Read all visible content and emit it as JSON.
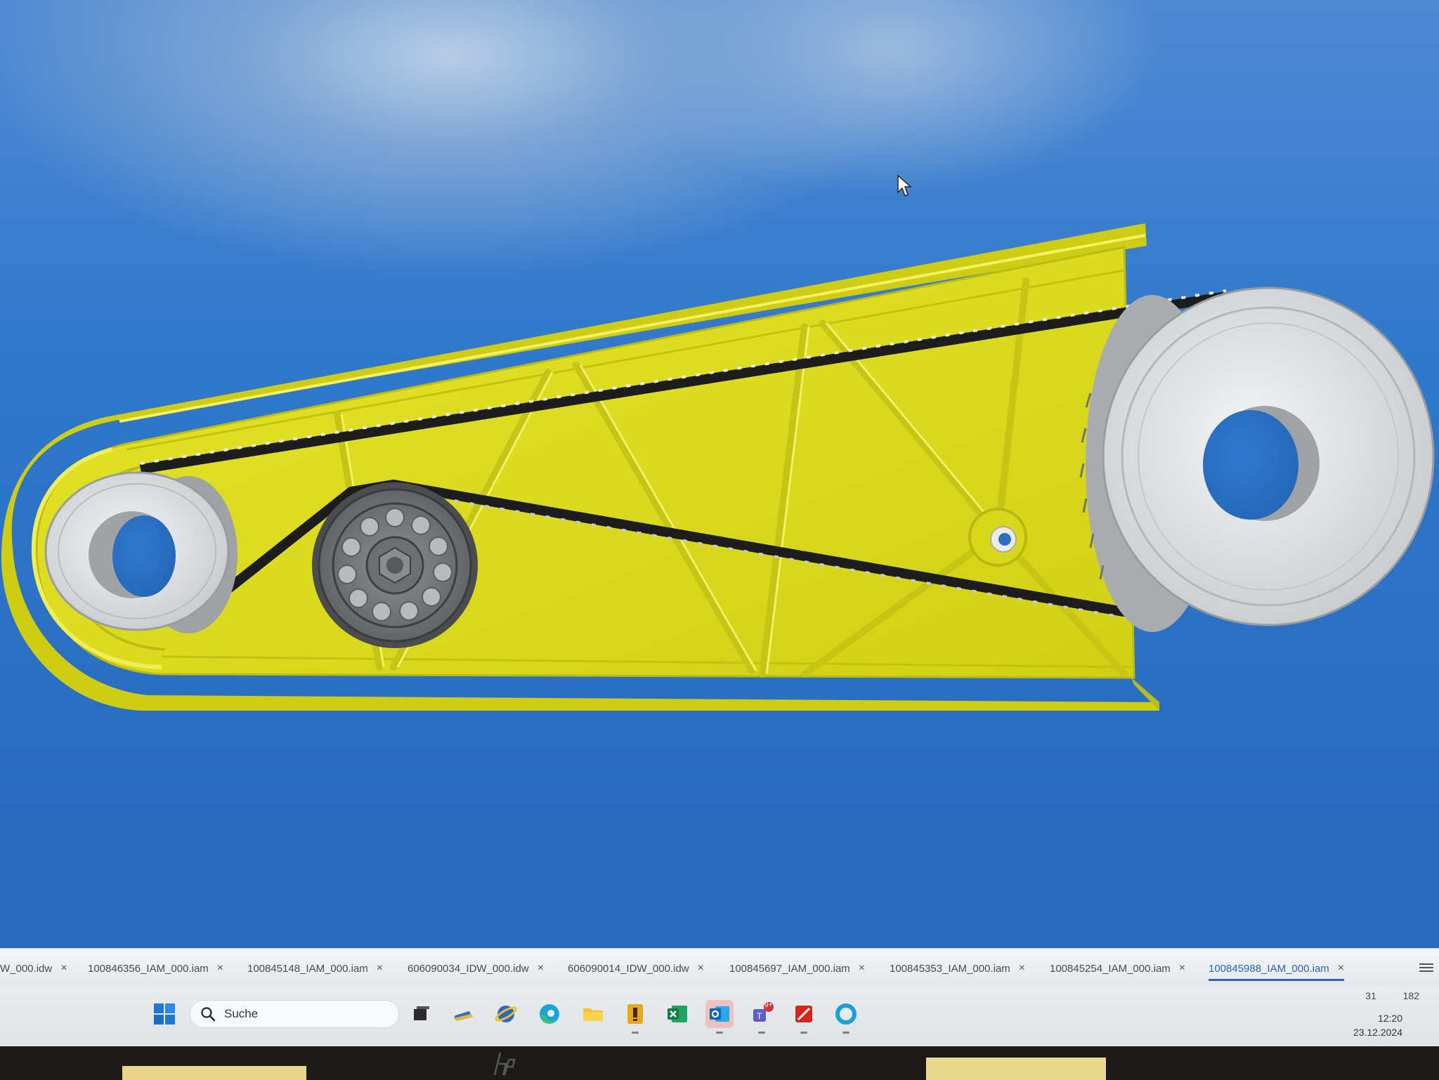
{
  "viewport": {
    "model_description_hidden": "",
    "colors": {
      "housing": "#e2e21a",
      "background": "#2d73c6",
      "belt": "#1c1c1c",
      "pulley": "#e4e6e8"
    }
  },
  "document_tabs": [
    {
      "label": "W_000.idw",
      "active": false
    },
    {
      "label": "100846356_IAM_000.iam",
      "active": false
    },
    {
      "label": "100845148_IAM_000.iam",
      "active": false
    },
    {
      "label": "606090034_IDW_000.idw",
      "active": false
    },
    {
      "label": "606090014_IDW_000.idw",
      "active": false
    },
    {
      "label": "100845697_IAM_000.iam",
      "active": false
    },
    {
      "label": "100845353_IAM_000.iam",
      "active": false
    },
    {
      "label": "100845254_IAM_000.iam",
      "active": false
    },
    {
      "label": "100845988_IAM_000.iam",
      "active": true
    }
  ],
  "close_glyph": "×",
  "status": {
    "value_a": "31",
    "value_b": "182"
  },
  "taskbar": {
    "search_label": "Suche",
    "apps": [
      {
        "icon": "task-view-icon"
      },
      {
        "icon": "file-manager-icon"
      },
      {
        "icon": "browser-icon"
      },
      {
        "icon": "edge-icon"
      },
      {
        "icon": "folder-icon"
      },
      {
        "icon": "inventor-icon",
        "running": true
      },
      {
        "icon": "excel-icon"
      },
      {
        "icon": "outlook-icon",
        "running": true,
        "focused": true
      },
      {
        "icon": "teams-icon",
        "running": true,
        "badge": "9+"
      },
      {
        "icon": "pdf-icon",
        "running": true
      },
      {
        "icon": "circle-app-icon",
        "running": true
      }
    ],
    "clock": {
      "time": "12:20",
      "date": "23.12.2024"
    }
  },
  "monitor": {
    "brand": "hp"
  }
}
